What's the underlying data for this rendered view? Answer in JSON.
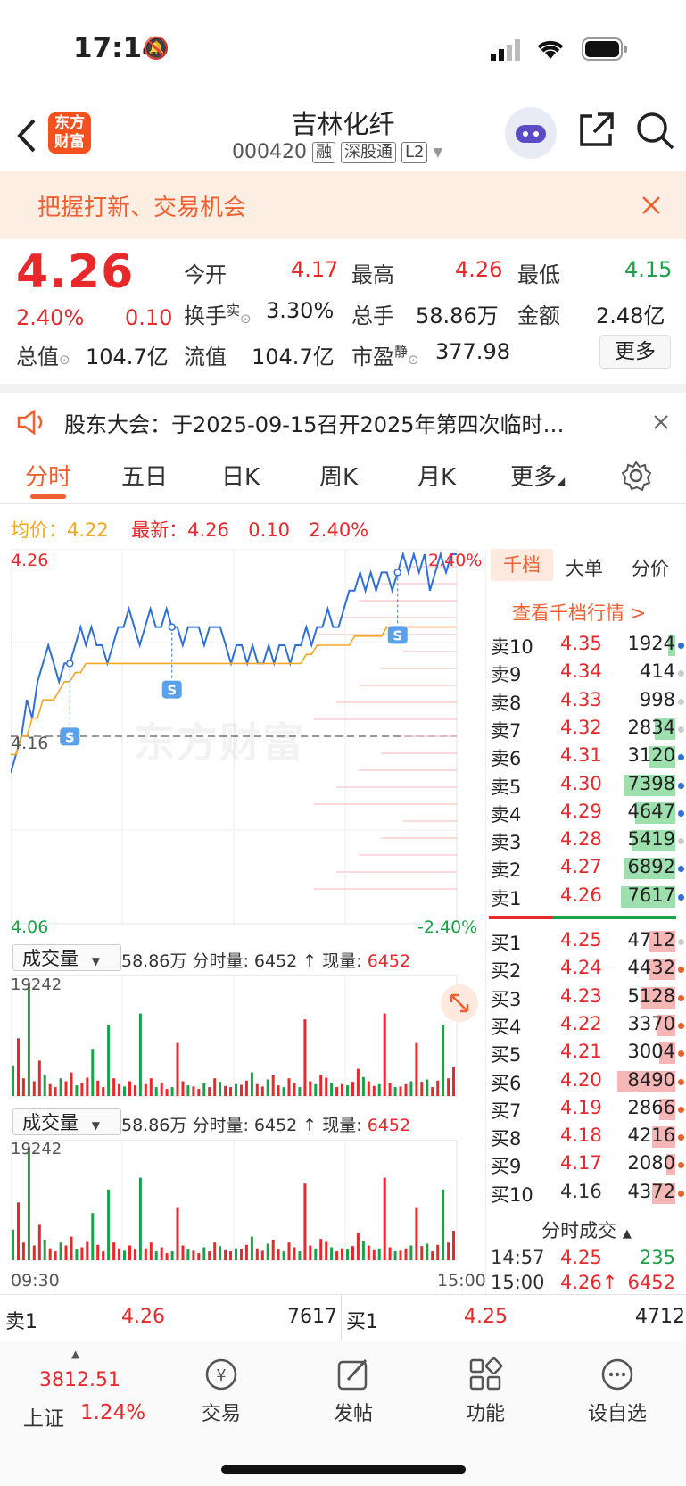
{
  "status_bar": {
    "time": "17:14"
  },
  "header": {
    "logo_text": "东方财富",
    "stock_name": "吉林化纤",
    "stock_code": "000420",
    "tags": [
      "融",
      "深股通",
      "L2"
    ]
  },
  "banner": {
    "text": "把握打新、交易机会"
  },
  "quote": {
    "price": "4.26",
    "change_pct": "2.40%",
    "change": "0.10",
    "open_label": "今开",
    "open": "4.17",
    "high_label": "最高",
    "high": "4.26",
    "low_label": "最低",
    "low": "4.15",
    "turnover_label": "换手",
    "turnover_sup": "实",
    "turnover": "3.30%",
    "volume_label": "总手",
    "volume": "58.86万",
    "amount_label": "金额",
    "amount": "2.48亿",
    "mktcap_label": "总值",
    "mktcap": "104.7亿",
    "float_label": "流值",
    "float": "104.7亿",
    "pe_label": "市盈",
    "pe_sup": "静",
    "pe": "377.98",
    "more_button": "更多"
  },
  "notice": {
    "text": "股东大会：于2025-09-15召开2025年第四次临时…"
  },
  "tabs": [
    "分时",
    "五日",
    "日K",
    "周K",
    "月K",
    "更多"
  ],
  "legend": {
    "avg_label": "均价：",
    "avg": "4.22",
    "latest_label": "最新：",
    "latest": "4.26",
    "change": "0.10",
    "change_pct": "2.40%"
  },
  "chart_data": {
    "type": "line",
    "title": "",
    "y_ticks": {
      "top": "4.26",
      "mid": "4.16",
      "bottom": "4.06"
    },
    "pct_ticks": {
      "top": "2.40%",
      "bottom": "-2.40%"
    },
    "x_ticks": {
      "start": "09:30",
      "end": "15:00"
    },
    "ylim": [
      4.06,
      4.26
    ],
    "prev_close": 4.16,
    "watermark": "东方财富",
    "series": [
      {
        "values": [
          4.14,
          4.15,
          4.16,
          4.18,
          4.17,
          4.19,
          4.2,
          4.21,
          4.2,
          4.19,
          4.2,
          4.2,
          4.21,
          4.22,
          4.21,
          4.22,
          4.21,
          4.21,
          4.2,
          4.21,
          4.22,
          4.22,
          4.23,
          4.22,
          4.21,
          4.22,
          4.23,
          4.22,
          4.22,
          4.23,
          4.22,
          4.22,
          4.21,
          4.22,
          4.22,
          4.22,
          4.21,
          4.22,
          4.22,
          4.22,
          4.21,
          4.2,
          4.21,
          4.21,
          4.2,
          4.21,
          4.2,
          4.2,
          4.21,
          4.2,
          4.21,
          4.21,
          4.2,
          4.21,
          4.21,
          4.22,
          4.21,
          4.22,
          4.22,
          4.23,
          4.22,
          4.22,
          4.23,
          4.24,
          4.24,
          4.25,
          4.24,
          4.25,
          4.24,
          4.25,
          4.25,
          4.24,
          4.25,
          4.26,
          4.25,
          4.26,
          4.25,
          4.26,
          4.24,
          4.25,
          4.26,
          4.25,
          4.26,
          4.26
        ]
      },
      {
        "values": [
          4.15,
          4.15,
          4.16,
          4.16,
          4.17,
          4.17,
          4.18,
          4.18,
          4.18,
          4.185,
          4.19,
          4.19,
          4.195,
          4.195,
          4.2,
          4.2,
          4.2,
          4.2,
          4.2,
          4.2,
          4.2,
          4.2,
          4.2,
          4.2,
          4.2,
          4.2,
          4.2,
          4.2,
          4.2,
          4.2,
          4.2,
          4.2,
          4.2,
          4.2,
          4.2,
          4.2,
          4.2,
          4.2,
          4.2,
          4.2,
          4.2,
          4.2,
          4.2,
          4.2,
          4.2,
          4.2,
          4.2,
          4.2,
          4.2,
          4.2,
          4.2,
          4.2,
          4.2,
          4.2,
          4.2,
          4.205,
          4.205,
          4.21,
          4.21,
          4.21,
          4.21,
          4.21,
          4.21,
          4.21,
          4.215,
          4.215,
          4.215,
          4.215,
          4.215,
          4.215,
          4.22,
          4.22,
          4.22,
          4.22,
          4.22,
          4.22,
          4.22,
          4.22,
          4.22,
          4.22,
          4.22,
          4.22,
          4.22,
          4.22
        ]
      }
    ],
    "volume": {
      "ymax": 19242,
      "values": [
        5200,
        9800,
        3000,
        19242,
        2500,
        6000,
        3500,
        2000,
        1500,
        3000,
        2500,
        4000,
        1800,
        2200,
        3100,
        8000,
        2600,
        1500,
        12000,
        3000,
        2000,
        1600,
        2500,
        1800,
        14000,
        2000,
        3000,
        1500,
        2200,
        1200,
        1500,
        9000,
        2500,
        1800,
        1600,
        1200,
        2200,
        1500,
        3000,
        2400,
        1700,
        1500,
        2000,
        1900,
        2600,
        4000,
        2000,
        1600,
        2800,
        3500,
        1800,
        1500,
        3000,
        2200,
        1500,
        13000,
        2500,
        2000,
        3600,
        3100,
        2200,
        1500,
        2000,
        1800,
        2400,
        4600,
        3200,
        2500,
        1700,
        2000,
        14000,
        2200,
        1500,
        1600,
        2000,
        2500,
        9000,
        2400,
        2800,
        1500,
        2600,
        12000,
        3000,
        5000
      ]
    },
    "markers": [
      "S",
      "S",
      "S"
    ]
  },
  "volume_panel": {
    "label": "成交量",
    "total": "58.86万",
    "period_label": "分时量:",
    "period_value": "6452",
    "current_label": "现量:",
    "current_value": "6452",
    "max_tick": "19242"
  },
  "order_book": {
    "tabs": [
      "千档",
      "大单",
      "分价"
    ],
    "link": "查看千档行情 >",
    "asks": [
      {
        "label": "卖10",
        "price": "4.35",
        "vol": "1924",
        "fill": 0.06,
        "dot": "#2f6fd6"
      },
      {
        "label": "卖9",
        "price": "4.34",
        "vol": "414",
        "fill": 0.0,
        "dot": "#cccccc"
      },
      {
        "label": "卖8",
        "price": "4.33",
        "vol": "998",
        "fill": 0.0,
        "dot": "#cccccc"
      },
      {
        "label": "卖7",
        "price": "4.32",
        "vol": "2834",
        "fill": 0.18,
        "dot": "#cccccc"
      },
      {
        "label": "卖6",
        "price": "4.31",
        "vol": "3120",
        "fill": 0.22,
        "dot": "#2f6fd6"
      },
      {
        "label": "卖5",
        "price": "4.30",
        "vol": "7398",
        "fill": 0.45,
        "dot": "#2f6fd6"
      },
      {
        "label": "卖4",
        "price": "4.29",
        "vol": "4647",
        "fill": 0.35,
        "dot": "#2f6fd6"
      },
      {
        "label": "卖3",
        "price": "4.28",
        "vol": "5419",
        "fill": 0.38,
        "dot": "#cccccc"
      },
      {
        "label": "卖2",
        "price": "4.27",
        "vol": "6892",
        "fill": 0.45,
        "dot": "#2f6fd6"
      },
      {
        "label": "卖1",
        "price": "4.26",
        "vol": "7617",
        "fill": 0.47,
        "dot": "#2f6fd6"
      }
    ],
    "bids": [
      {
        "label": "买1",
        "price": "4.25",
        "vol": "4712",
        "fill": 0.22,
        "dot": "#cccccc"
      },
      {
        "label": "买2",
        "price": "4.24",
        "vol": "4432",
        "fill": 0.22,
        "dot": "#e8612b"
      },
      {
        "label": "买3",
        "price": "4.23",
        "vol": "5128",
        "fill": 0.3,
        "dot": "#e8612b"
      },
      {
        "label": "买4",
        "price": "4.22",
        "vol": "3370",
        "fill": 0.16,
        "dot": "#e8612b"
      },
      {
        "label": "买5",
        "price": "4.21",
        "vol": "3004",
        "fill": 0.14,
        "dot": "#e8612b"
      },
      {
        "label": "买6",
        "price": "4.20",
        "vol": "8490",
        "fill": 0.5,
        "dot": "#e8612b"
      },
      {
        "label": "买7",
        "price": "4.19",
        "vol": "2866",
        "fill": 0.14,
        "dot": "#e8612b"
      },
      {
        "label": "买8",
        "price": "4.18",
        "vol": "4216",
        "fill": 0.2,
        "dot": "#e8612b"
      },
      {
        "label": "买9",
        "price": "4.17",
        "vol": "2080",
        "fill": 0.08,
        "dot": "#e8612b"
      },
      {
        "label": "买10",
        "price": "4.16",
        "vol": "4372",
        "fill": 0.2,
        "dot": "#e8612b"
      }
    ],
    "ticks_title": "分时成交",
    "ticks": [
      {
        "time": "14:57",
        "price": "4.25",
        "vol": "235"
      },
      {
        "time": "15:00",
        "price": "4.26↑",
        "vol": "6452"
      }
    ]
  },
  "bbo": {
    "ask_label": "卖1",
    "ask_price": "4.26",
    "ask_vol": "7617",
    "bid_label": "买1",
    "bid_price": "4.25",
    "bid_vol": "4712"
  },
  "bottom_nav": {
    "index_value": "3812.51",
    "index_name": "上证",
    "index_pct": "1.24%",
    "items": [
      "交易",
      "发帖",
      "功能",
      "设自选"
    ]
  }
}
